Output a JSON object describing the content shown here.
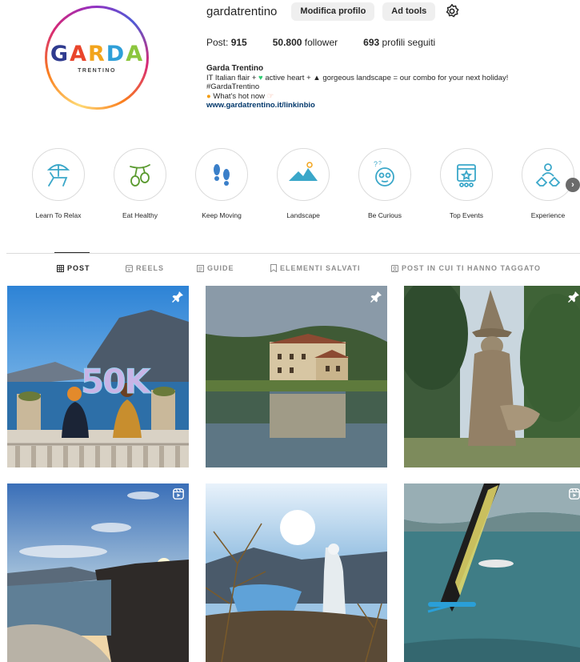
{
  "profile": {
    "username": "gardatrentino",
    "edit_label": "Modifica profilo",
    "adtools_label": "Ad tools",
    "logo_letters": [
      "G",
      "A",
      "R",
      "D",
      "A"
    ],
    "logo_colors": [
      "#2f3b8f",
      "#e9452b",
      "#f2a41c",
      "#2f9fd8",
      "#8cc63e"
    ],
    "logo_subtitle": "TRENTINO"
  },
  "stats": {
    "posts_label": "Post:",
    "posts_value": "915",
    "followers_value": "50.800",
    "followers_label": "follower",
    "following_value": "693",
    "following_label": "profili seguiti"
  },
  "bio": {
    "name": "Garda Trentino",
    "line1_a": "IT Italian flair +",
    "line1_b": "active heart +",
    "line1_c": "gorgeous landscape = our combo for your next holiday!",
    "line2": "#GardaTrentino",
    "line3": "What's hot now",
    "link": "www.gardatrentino.it/linkinbio"
  },
  "highlights": [
    {
      "label": "Learn To Relax",
      "icon": "beach-chair-icon"
    },
    {
      "label": "Eat Healthy",
      "icon": "olive-branch-icon"
    },
    {
      "label": "Keep Moving",
      "icon": "footprints-icon"
    },
    {
      "label": "Landscape",
      "icon": "mountain-icon"
    },
    {
      "label": "Be Curious",
      "icon": "curious-face-icon"
    },
    {
      "label": "Top Events",
      "icon": "calendar-event-icon"
    },
    {
      "label": "Experience",
      "icon": "people-group-icon"
    }
  ],
  "tabs": {
    "post": "POST",
    "reels": "REELS",
    "guide": "GUIDE",
    "saved": "ELEMENTI SALVATI",
    "tagged": "POST IN CUI TI HANNO TAGGATO"
  },
  "grid": [
    {
      "badge": "pin-icon",
      "overlay_text": "50K"
    },
    {
      "badge": "pin-icon"
    },
    {
      "badge": "pin-icon"
    },
    {
      "badge": "reel-icon"
    },
    {
      "badge": "none"
    },
    {
      "badge": "reel-icon"
    }
  ],
  "colors": {
    "accent_link": "#00376b",
    "button_bg": "#efefef",
    "heart": "#2ecc71",
    "text": "#262626",
    "muted": "#8e8e8e"
  }
}
